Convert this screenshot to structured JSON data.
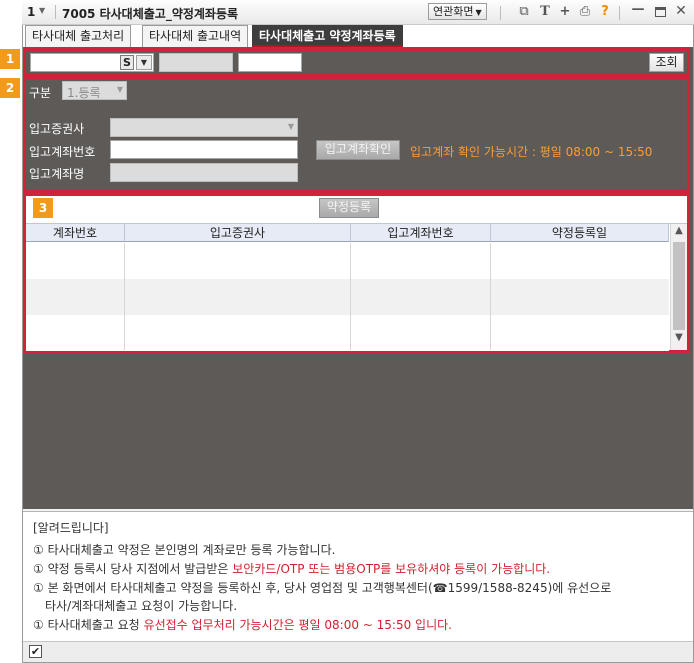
{
  "titlebar": {
    "screen_num": "1",
    "title": "7005 타사대체출고_약정계좌등록",
    "related_btn": "연관화면"
  },
  "tabs": [
    {
      "label": "타사대체 출고처리",
      "active": false
    },
    {
      "label": "타사대체 출고내역",
      "active": false
    },
    {
      "label": "타사대체출고 약정계좌등록",
      "active": true
    }
  ],
  "section_numbers": [
    "1",
    "2",
    "3"
  ],
  "section1": {
    "s_label": "S",
    "query_btn": "조회"
  },
  "section2": {
    "category_label": "구분",
    "category_value": "1.등록",
    "broker_label": "입고증권사",
    "account_no_label": "입고계좌번호",
    "confirm_btn": "입고계좌확인",
    "hint": "입고계좌 확인 가능시간 : 평일 08:00 ~ 15:50",
    "account_name_label": "입고계좌명"
  },
  "section3": {
    "register_btn": "약정등록",
    "columns": [
      "계좌번호",
      "입고증권사",
      "입고계좌번호",
      "약정등록일"
    ]
  },
  "notice": {
    "heading": "[알려드립니다]",
    "line1": "① 타사대체출고 약정은 본인명의 계좌로만 등록 가능합니다.",
    "line2_a": "① 약정 등록시 당사 지점에서 발급받은 ",
    "line2_red": "보안카드/OTP 또는 범용OTP를 보유하셔야 등록이 가능합니다.",
    "line3": "① 본 화면에서 타사대체출고 약정을 등록하신 후, 당사 영업점 및 고객행복센터(☎1599/1588-8245)에 유선으로",
    "line3b": "타사/계좌대체출고 요청이 가능합니다.",
    "line4_a": "① 타사대체출고 요청 ",
    "line4_red": "유선접수 업무처리 가능시간은 평일 08:00 ~ 15:50 입니다."
  },
  "colors": {
    "accent_red": "#d0223b",
    "badge_orange": "#f29a1c",
    "hint_orange": "#ff9c33",
    "panel_dark": "#5d5a58"
  },
  "icons": [
    "chevron-down-icon",
    "window-link-icon",
    "text-icon",
    "plus-icon",
    "print-icon",
    "help-icon",
    "minimize-icon",
    "maximize-icon",
    "close-icon",
    "checkbox-check-icon"
  ]
}
